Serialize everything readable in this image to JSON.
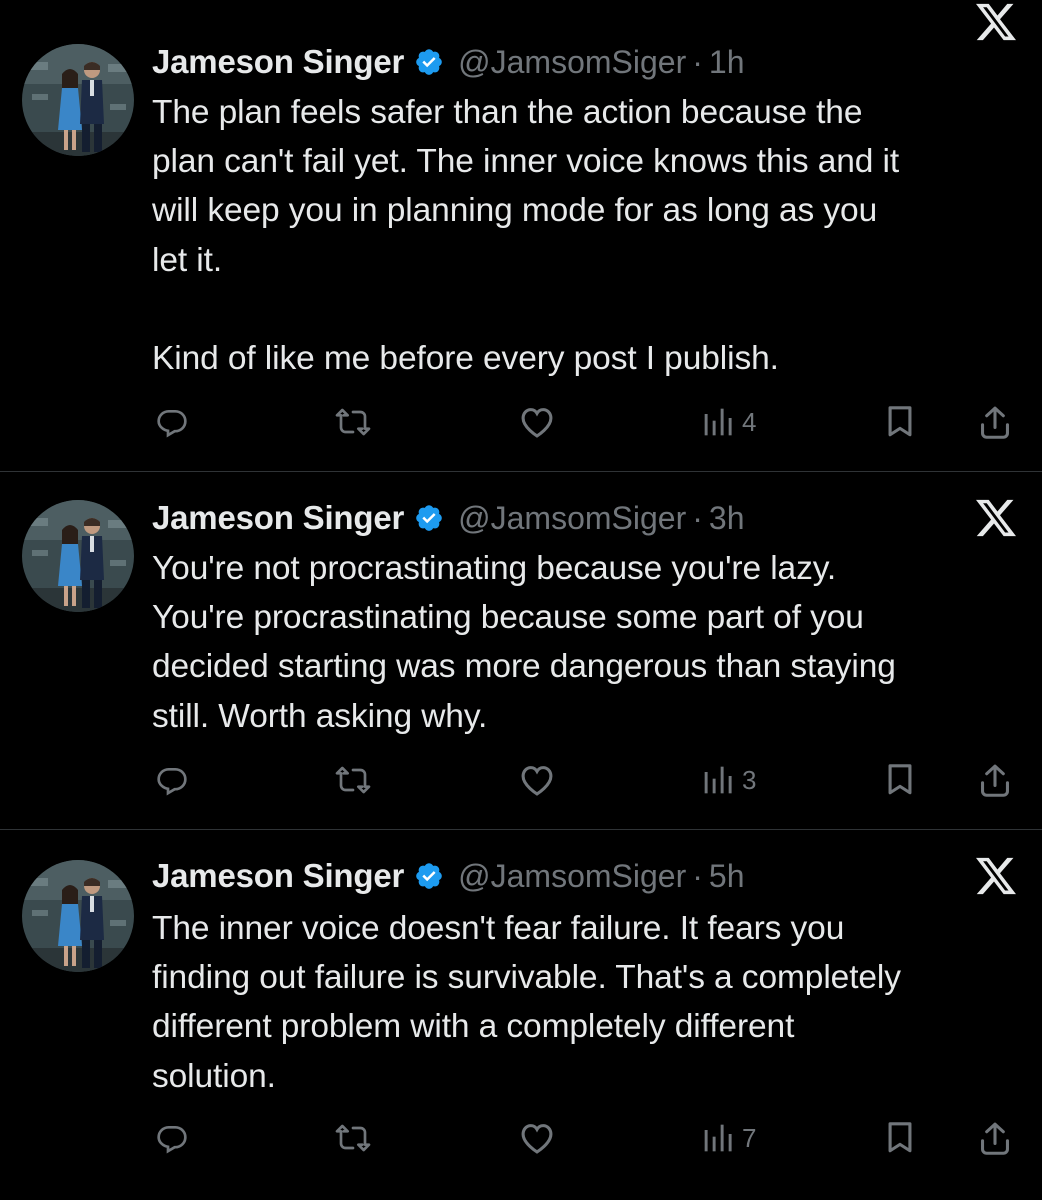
{
  "feed": {
    "tweets": [
      {
        "author_name": "Jameson Singer",
        "handle": "@JamsomSiger",
        "separator": "·",
        "time": "1h",
        "text": "The plan feels safer than the action because the\nplan can't fail yet. The inner voice knows this and it\nwill keep you in planning mode for as long as you\nlet it.\n\nKind of like me before every post I publish.",
        "views": "4"
      },
      {
        "author_name": "Jameson Singer",
        "handle": "@JamsomSiger",
        "separator": "·",
        "time": "3h",
        "text": "You're not procrastinating because you're lazy.\nYou're procrastinating because some part of you\ndecided starting was more dangerous than staying\nstill. Worth asking why.",
        "views": "3"
      },
      {
        "author_name": "Jameson Singer",
        "handle": "@JamsomSiger",
        "separator": "·",
        "time": "5h",
        "text": "The inner voice doesn't fear failure. It fears you\nfinding out failure is survivable. That's a completely\ndifferent problem with a completely different\nsolution.",
        "views": "7"
      }
    ]
  },
  "icons": {
    "verified": "verified-badge-icon",
    "platform": "x-logo-icon",
    "reply": "reply-icon",
    "repost": "repost-icon",
    "like": "heart-icon",
    "views": "views-icon",
    "bookmark": "bookmark-icon",
    "share": "share-icon"
  },
  "colors": {
    "background": "#000000",
    "text": "#e7e9ea",
    "muted": "#71767b",
    "verified": "#1d9bf0",
    "divider": "#2f3336"
  }
}
